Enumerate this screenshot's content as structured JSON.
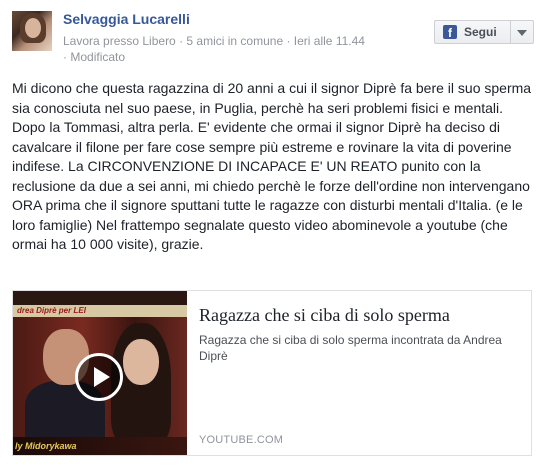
{
  "post": {
    "author_name": "Selvaggia Lucarelli",
    "meta_workplace": "Lavora presso Libero",
    "meta_separator": " · ",
    "meta_mutual_friends": "5 amici in comune",
    "meta_time": "Ieri alle 11.44",
    "meta_edited": "Modificato",
    "follow_button": {
      "label": "Segui",
      "icon": "facebook-f-icon",
      "icon_glyph": "f"
    },
    "body_text": "Mi dicono che questa ragazzina di 20 anni a cui il signor Diprè fa bere il suo sperma sia conosciuta nel suo paese, in Puglia, perchè ha seri problemi fisici e mentali. Dopo la Tommasi, altra perla. E' evidente che ormai il signor Diprè ha deciso di cavalcare il filone per fare cose sempre più estreme e rovinare la vita di poverine indifese. La CIRCONVENZIONE DI INCAPACE E' UN REATO punito con la reclusione da due a sei anni, mi chiedo perchè le forze dell'ordine non intervengano ORA prima che il signore sputtani tutte le ragazze con disturbi mentali d'Italia. (e le loro famiglie) Nel frattempo segnalate questo video abominevole a youtube (che ormai ha 10 000 visite), grazie."
  },
  "link_card": {
    "thumbnail": {
      "banner_text": "drea Diprè per LEI",
      "caption_text": "ly Midorykawa",
      "play_icon": "play-icon"
    },
    "title": "Ragazza che si ciba di solo sperma",
    "description": "Ragazza che si ciba di solo sperma incontrata da Andrea Diprè",
    "domain": "YOUTUBE.COM"
  },
  "colors": {
    "link_blue": "#365899",
    "meta_gray": "#90949c",
    "text": "#1d2129",
    "facebook_blue": "#3b5998",
    "border": "#dddfe2"
  }
}
